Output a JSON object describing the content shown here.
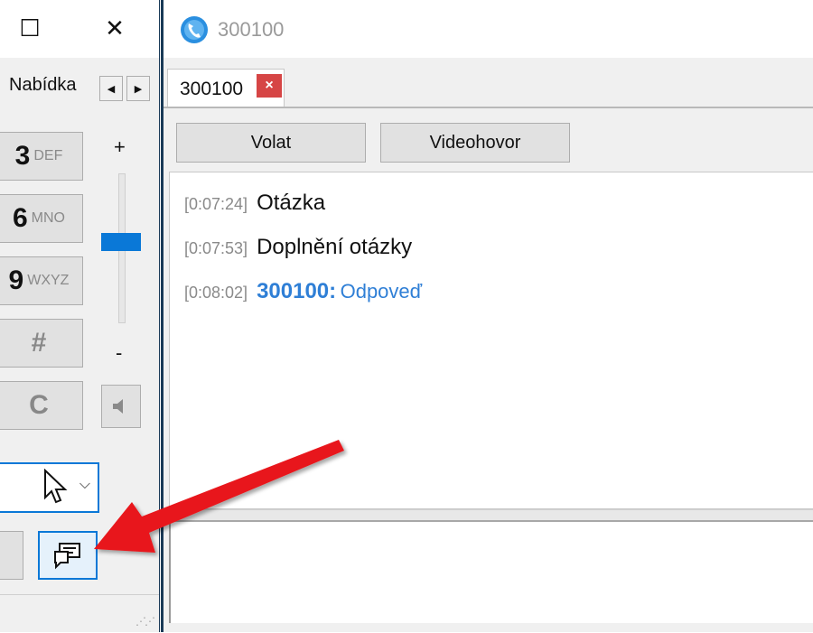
{
  "left_window": {
    "controls": {
      "maximize": "☐",
      "close": "✕"
    },
    "menu_label": "Nabídka",
    "scroll_left": "◀",
    "scroll_right": "▶",
    "keypad": [
      {
        "digit": "3",
        "letters": "DEF"
      },
      {
        "digit": "6",
        "letters": "MNO"
      },
      {
        "digit": "9",
        "letters": "WXYZ"
      },
      {
        "digit": "#",
        "letters": ""
      },
      {
        "digit": "C",
        "letters": ""
      }
    ],
    "volume": {
      "plus": "+",
      "minus": "-",
      "level": 0.55
    },
    "number_field": {
      "value": ""
    }
  },
  "right_window": {
    "title": "300100",
    "tab": {
      "label": "300100",
      "close": "×"
    },
    "buttons": {
      "call": "Volat",
      "video": "Videohovor"
    },
    "messages": [
      {
        "time": "[0:07:24]",
        "sender": "",
        "text": "Otázka",
        "mine": false
      },
      {
        "time": "[0:07:53]",
        "sender": "",
        "text": "Doplnění otázky",
        "mine": false
      },
      {
        "time": "[0:08:02]",
        "sender": "300100:",
        "text": "Odpoveď",
        "mine": true
      }
    ],
    "compose": {
      "value": ""
    }
  },
  "colors": {
    "accent": "#0a78d7",
    "sender_blue": "#2f7fd6",
    "tab_close_red": "#d64545",
    "arrow_red": "#e8191b"
  }
}
